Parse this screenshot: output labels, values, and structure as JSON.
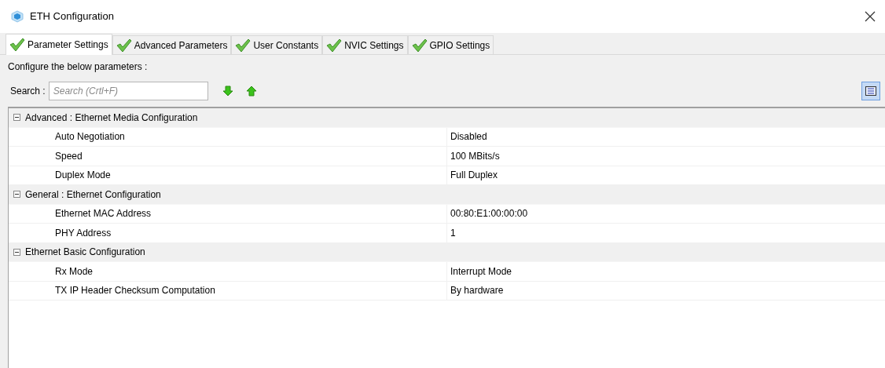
{
  "window": {
    "title": "ETH Configuration"
  },
  "tabs": [
    {
      "label": "Parameter Settings",
      "selected": true
    },
    {
      "label": "Advanced Parameters",
      "selected": false
    },
    {
      "label": "User Constants",
      "selected": false
    },
    {
      "label": "NVIC Settings",
      "selected": false
    },
    {
      "label": "GPIO Settings",
      "selected": false
    }
  ],
  "instructions": "Configure the below parameters :",
  "search": {
    "label": "Search :",
    "placeholder": "Search (Crtl+F)"
  },
  "groups": [
    {
      "title": "Advanced : Ethernet Media Configuration",
      "expanded": true,
      "rows": [
        {
          "name": "Auto Negotiation",
          "value": "Disabled"
        },
        {
          "name": "Speed",
          "value": "100 MBits/s"
        },
        {
          "name": "Duplex Mode",
          "value": "Full Duplex"
        }
      ]
    },
    {
      "title": "General : Ethernet Configuration",
      "expanded": true,
      "rows": [
        {
          "name": "Ethernet MAC Address",
          "value": "00:80:E1:00:00:00"
        },
        {
          "name": "PHY Address",
          "value": "1"
        }
      ]
    },
    {
      "title": "Ethernet Basic Configuration",
      "expanded": true,
      "rows": [
        {
          "name": "Rx Mode",
          "value": "Interrupt Mode"
        },
        {
          "name": "TX IP Header Checksum Computation",
          "value": "By hardware"
        }
      ]
    }
  ]
}
